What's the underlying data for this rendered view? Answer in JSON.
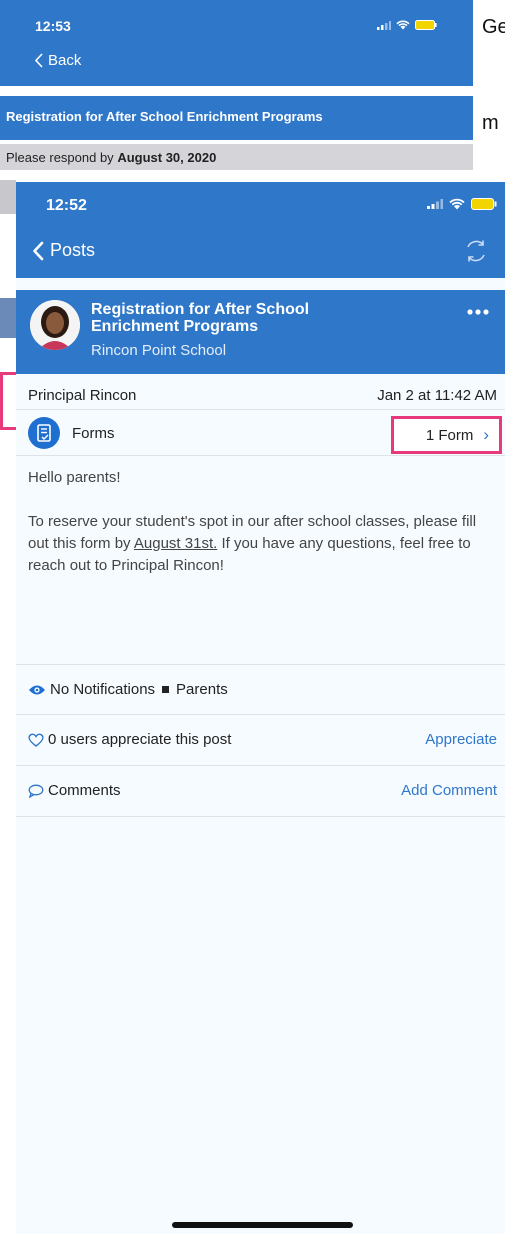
{
  "background_screen": {
    "time": "12:53",
    "back_label": "Back",
    "title": "Registration for After School Enrichment Programs",
    "respond_prefix": "Please respond by",
    "respond_date": "August 30, 2020",
    "side_text_top": "Ge",
    "side_text_bottom": "m"
  },
  "header": {
    "time": "12:52",
    "back_label": "Posts"
  },
  "post": {
    "title": "Registration for After School Enrichment Programs",
    "school": "Rincon Point School",
    "author": "Principal Rincon",
    "date": "Jan 2 at 11:42 AM",
    "forms_label": "Forms",
    "forms_count": "1 Form",
    "body_greeting": "Hello parents!",
    "body_part1": "To reserve your student's spot in our after school classes, please fill out this form by ",
    "body_date": "August 31st.",
    "body_part2": " If you have any questions, feel free to reach out to Principal Rincon!",
    "visibility": "No Notifications",
    "audience": "Parents",
    "appreciation_text": "0 users appreciate this post",
    "appreciate_label": "Appreciate",
    "comments_label": "Comments",
    "add_comment_label": "Add Comment"
  },
  "colors": {
    "brand_blue": "#2f77c9",
    "highlight_pink": "#e8397d",
    "link_blue": "#2f77c9"
  }
}
